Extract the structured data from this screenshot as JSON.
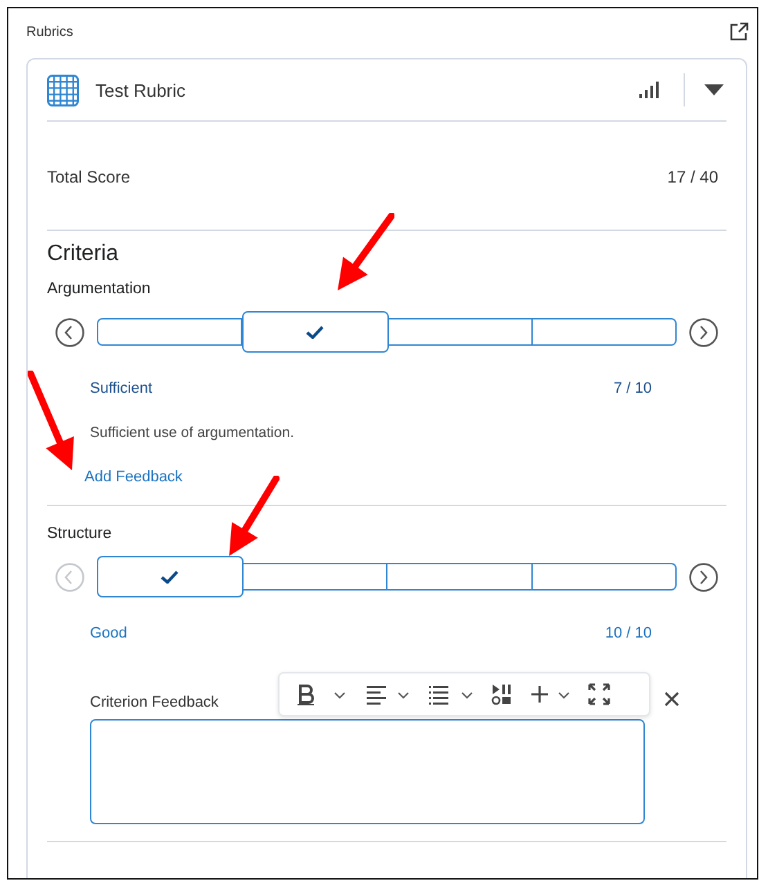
{
  "panel": {
    "title": "Rubrics"
  },
  "rubric": {
    "name": "Test Rubric"
  },
  "total": {
    "label": "Total Score",
    "score": "17 / 40"
  },
  "criteria_heading": "Criteria",
  "criteria": [
    {
      "name": "Argumentation",
      "levels": [
        {
          "selected": false
        },
        {
          "selected": true
        },
        {
          "selected": false
        },
        {
          "selected": false
        }
      ],
      "level_name": "Sufficient",
      "score": "7 / 10",
      "description": "Sufficient use of argumentation.",
      "feedback": {
        "kind": "link",
        "label": "Add Feedback"
      }
    },
    {
      "name": "Structure",
      "levels": [
        {
          "selected": true
        },
        {
          "selected": false
        },
        {
          "selected": false
        },
        {
          "selected": false
        }
      ],
      "level_name": "Good",
      "score": "10 / 10",
      "feedback": {
        "kind": "editor",
        "label": "Criterion Feedback"
      }
    }
  ]
}
